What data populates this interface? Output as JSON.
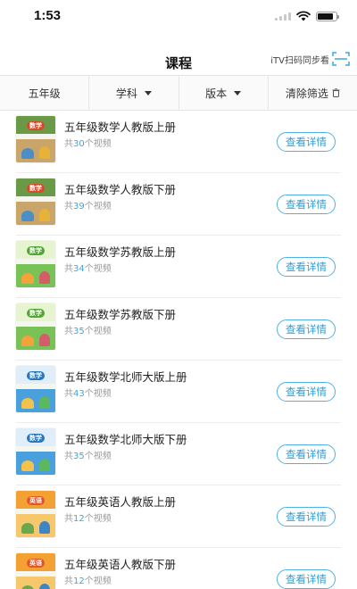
{
  "status": {
    "time": "1:53",
    "battery_level": 0.85,
    "colors": {
      "icons": "#111111"
    }
  },
  "header": {
    "title": "课程",
    "scan_label": "iTV扫码同步看",
    "scan_icon": "scan-icon"
  },
  "filters": [
    {
      "label": "五年级",
      "dropdown": false
    },
    {
      "label": "学科",
      "dropdown": true
    },
    {
      "label": "版本",
      "dropdown": true
    },
    {
      "label": "清除筛选",
      "dropdown": false,
      "icon": "trash-icon"
    }
  ],
  "courses": [
    {
      "title": "五年级数学人教版上册",
      "count_prefix": "共",
      "count": "30",
      "count_suffix": "个视频",
      "button": "查看详情",
      "cover_badge": "数学",
      "cover_style": "pep-math"
    },
    {
      "title": "五年级数学人教版下册",
      "count_prefix": "共",
      "count": "39",
      "count_suffix": "个视频",
      "button": "查看详情",
      "cover_badge": "数学",
      "cover_style": "pep-math"
    },
    {
      "title": "五年级数学苏教版上册",
      "count_prefix": "共",
      "count": "34",
      "count_suffix": "个视频",
      "button": "查看详情",
      "cover_badge": "数学",
      "cover_style": "su-math"
    },
    {
      "title": "五年级数学苏教版下册",
      "count_prefix": "共",
      "count": "35",
      "count_suffix": "个视频",
      "button": "查看详情",
      "cover_badge": "数学",
      "cover_style": "su-math"
    },
    {
      "title": "五年级数学北师大版上册",
      "count_prefix": "共",
      "count": "43",
      "count_suffix": "个视频",
      "button": "查看详情",
      "cover_badge": "数学",
      "cover_style": "bsd-math"
    },
    {
      "title": "五年级数学北师大版下册",
      "count_prefix": "共",
      "count": "35",
      "count_suffix": "个视频",
      "button": "查看详情",
      "cover_badge": "数学",
      "cover_style": "bsd-math"
    },
    {
      "title": "五年级英语人教版上册",
      "count_prefix": "共",
      "count": "12",
      "count_suffix": "个视频",
      "button": "查看详情",
      "cover_badge": "英语",
      "cover_style": "pep-english"
    },
    {
      "title": "五年级英语人教版下册",
      "count_prefix": "共",
      "count": "12",
      "count_suffix": "个视频",
      "button": "查看详情",
      "cover_badge": "英语",
      "cover_style": "pep-english"
    }
  ],
  "colors": {
    "accent": "#2f9bd8",
    "count_number": "#3aa7e0",
    "muted_text": "#9a9a9a",
    "divider": "#ececec"
  }
}
